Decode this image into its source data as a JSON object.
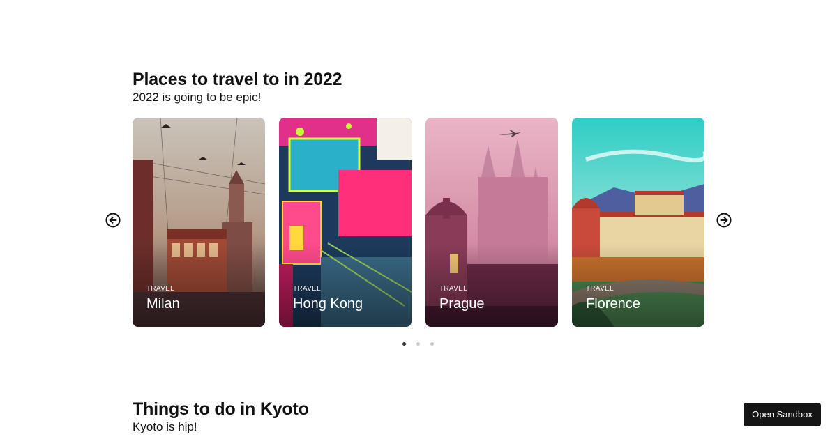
{
  "sections": [
    {
      "title": "Places to travel to in 2022",
      "subtitle": "2022 is going to be epic!",
      "cards": [
        {
          "category": "TRAVEL",
          "city": "Milan"
        },
        {
          "category": "TRAVEL",
          "city": "Hong Kong"
        },
        {
          "category": "TRAVEL",
          "city": "Prague"
        },
        {
          "category": "TRAVEL",
          "city": "Florence"
        }
      ]
    },
    {
      "title": "Things to do in Kyoto",
      "subtitle": "Kyoto is hip!"
    }
  ],
  "carousel": {
    "prev_icon": "arrow-left-circle-icon",
    "next_icon": "arrow-right-circle-icon",
    "page_count": 3,
    "active_page": 1
  },
  "sandbox_button": {
    "label": "Open Sandbox"
  },
  "colors": {
    "milan_sky": "#b8ad9f",
    "hongkong_bg": "#1d3a5c",
    "hongkong_neon": "#ff2f7a",
    "prague_sky": "#e6a3b8",
    "florence_sky": "#2ecdc6",
    "button_bg": "#151515"
  }
}
